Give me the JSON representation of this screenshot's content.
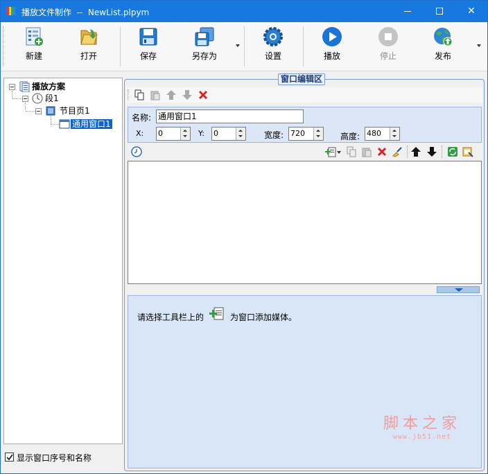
{
  "window": {
    "title": "播放文件制作  --  NewList.plpym",
    "controls": {
      "minimize": "minimize-icon",
      "maximize": "maximize-icon",
      "close": "✕"
    }
  },
  "toolbar": {
    "new_label": "新建",
    "open_label": "打开",
    "save_label": "保存",
    "saveas_label": "另存为",
    "settings_label": "设置",
    "play_label": "播放",
    "stop_label": "停止",
    "publish_label": "发布"
  },
  "tree": {
    "root": "播放方案",
    "segment": "段1",
    "page": "节目页1",
    "window": "通用窗口1"
  },
  "options": {
    "show_window_index_label": "显示窗口序号和名称",
    "show_window_index_checked": true
  },
  "editor": {
    "group_title": "窗口编辑区",
    "name_label": "名称:",
    "name_value": "通用窗口1",
    "x_label": "X:",
    "x_value": "0",
    "y_label": "Y:",
    "y_value": "0",
    "width_label": "宽度:",
    "width_value": "720",
    "height_label": "高度:",
    "height_value": "480",
    "hint_before": "请选择工具栏上的",
    "hint_after": "为窗口添加媒体。"
  },
  "watermark": {
    "main": "脚本之家",
    "url": "www.jb51.net"
  },
  "colors": {
    "titlebar": "#1778e0",
    "selection": "#0a64d6",
    "info_pane": "#d9e6f7",
    "delete_red": "#e02020"
  }
}
